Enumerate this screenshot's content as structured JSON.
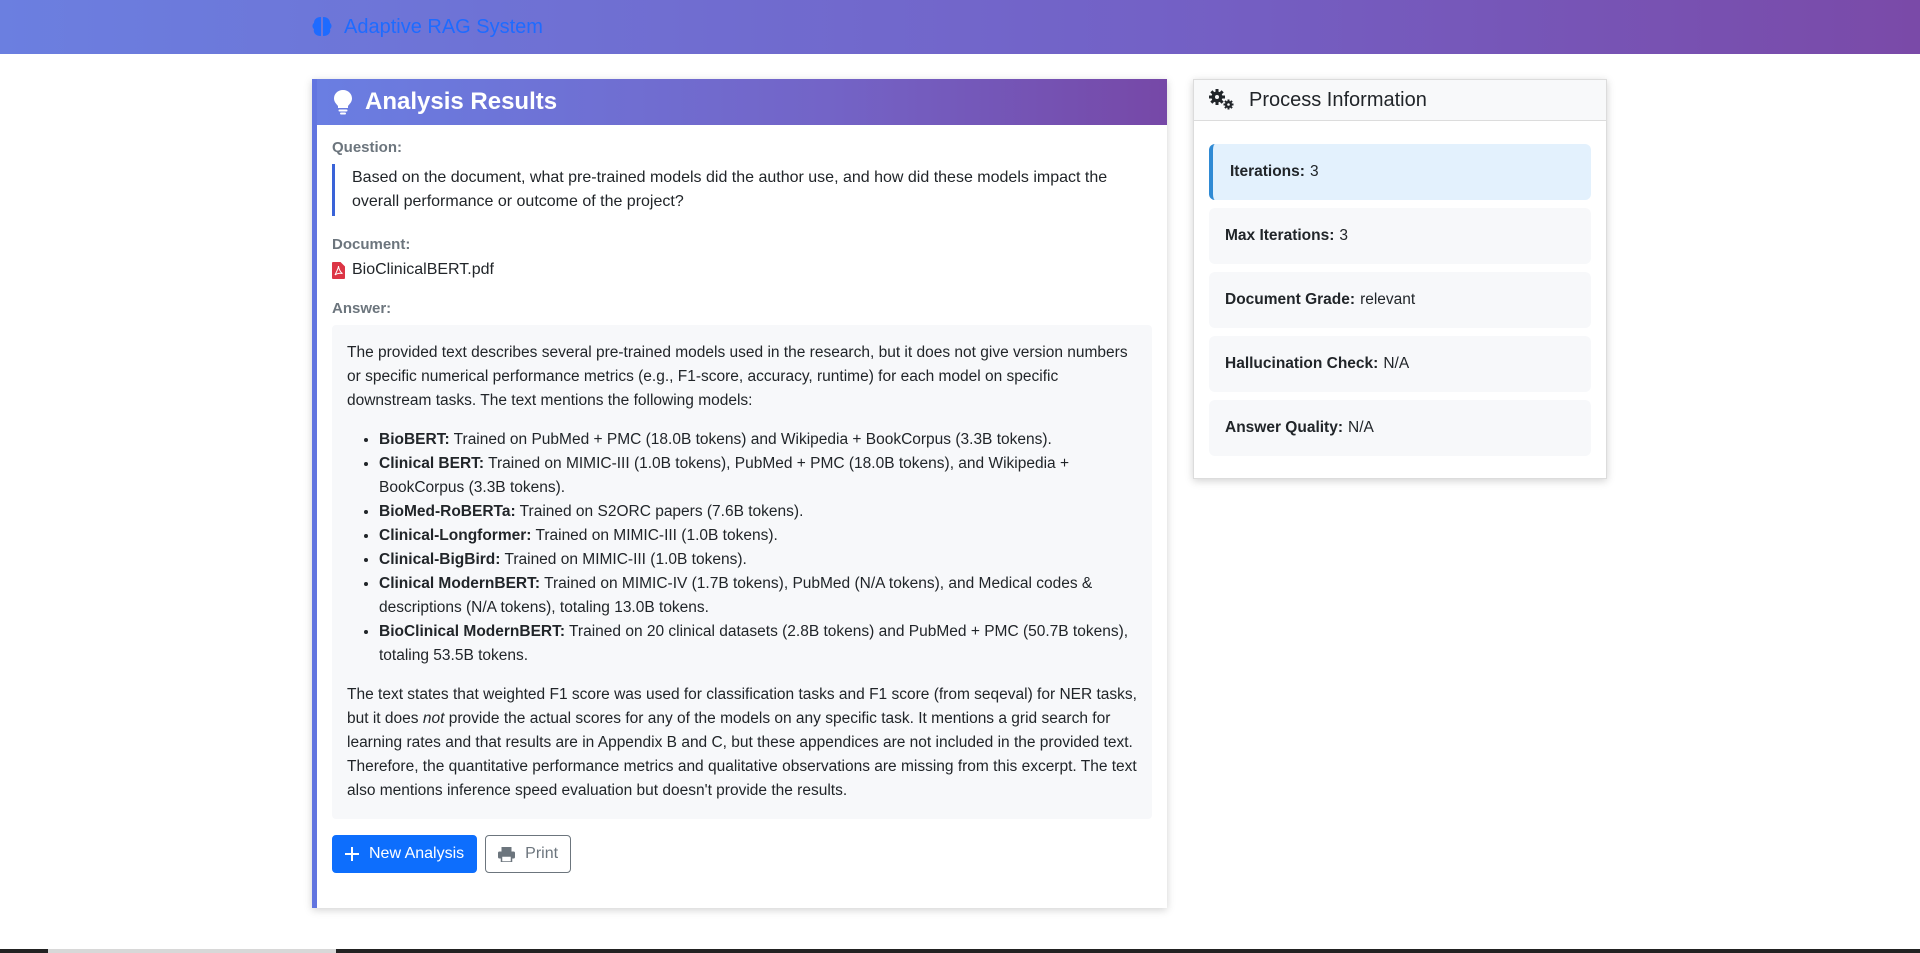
{
  "navbar": {
    "brand": "Adaptive RAG System",
    "brand_icon": "brain-icon"
  },
  "results": {
    "title": "Analysis Results",
    "title_icon": "lightbulb-icon",
    "question_label": "Question:",
    "question": "Based on the document, what pre-trained models did the author use, and how did these models impact the overall performance or outcome of the project?",
    "document_label": "Document:",
    "document_name": "BioClinicalBERT.pdf",
    "document_icon": "pdf-file-icon",
    "answer_label": "Answer:",
    "answer": {
      "intro": "The provided text describes several pre-trained models used in the research, but it does not give version numbers or specific numerical performance metrics (e.g., F1-score, accuracy, runtime) for each model on specific downstream tasks. The text mentions the following models:",
      "models": [
        {
          "name": "BioBERT:",
          "desc": " Trained on PubMed + PMC (18.0B tokens) and Wikipedia + BookCorpus (3.3B tokens)."
        },
        {
          "name": "Clinical BERT:",
          "desc": " Trained on MIMIC-III (1.0B tokens), PubMed + PMC (18.0B tokens), and Wikipedia + BookCorpus (3.3B tokens)."
        },
        {
          "name": "BioMed-RoBERTa:",
          "desc": " Trained on S2ORC papers (7.6B tokens)."
        },
        {
          "name": "Clinical-Longformer:",
          "desc": " Trained on MIMIC-III (1.0B tokens)."
        },
        {
          "name": "Clinical-BigBird:",
          "desc": " Trained on MIMIC-III (1.0B tokens)."
        },
        {
          "name": "Clinical ModernBERT:",
          "desc": " Trained on MIMIC-IV (1.7B tokens), PubMed (N/A tokens), and Medical codes & descriptions (N/A tokens), totaling 13.0B tokens."
        },
        {
          "name": "BioClinical ModernBERT:",
          "desc": " Trained on 20 clinical datasets (2.8B tokens) and PubMed + PMC (50.7B tokens), totaling 53.5B tokens."
        }
      ],
      "outro_pre": "The text states that weighted F1 score was used for classification tasks and F1 score (from seqeval) for NER tasks, but it does ",
      "outro_em": "not",
      "outro_post": " provide the actual scores for any of the models on any specific task. It mentions a grid search for learning rates and that results are in Appendix B and C, but these appendices are not included in the provided text. Therefore, the quantitative performance metrics and qualitative observations are missing from this excerpt. The text also mentions inference speed evaluation but doesn't provide the results."
    },
    "new_analysis_label": "New Analysis",
    "print_label": "Print"
  },
  "process": {
    "title": "Process Information",
    "title_icon": "gears-icon",
    "items": [
      {
        "label": "Iterations:",
        "value": "3"
      },
      {
        "label": "Max Iterations:",
        "value": "3"
      },
      {
        "label": "Document Grade:",
        "value": "relevant"
      },
      {
        "label": "Hallucination Check:",
        "value": "N/A"
      },
      {
        "label": "Answer Quality:",
        "value": "N/A"
      }
    ]
  },
  "colors": {
    "accent": "#0d6efd",
    "header_gradient_start": "#6a7ee2",
    "header_gradient_end": "#7648a7",
    "active_item": "#e3f1fd"
  }
}
